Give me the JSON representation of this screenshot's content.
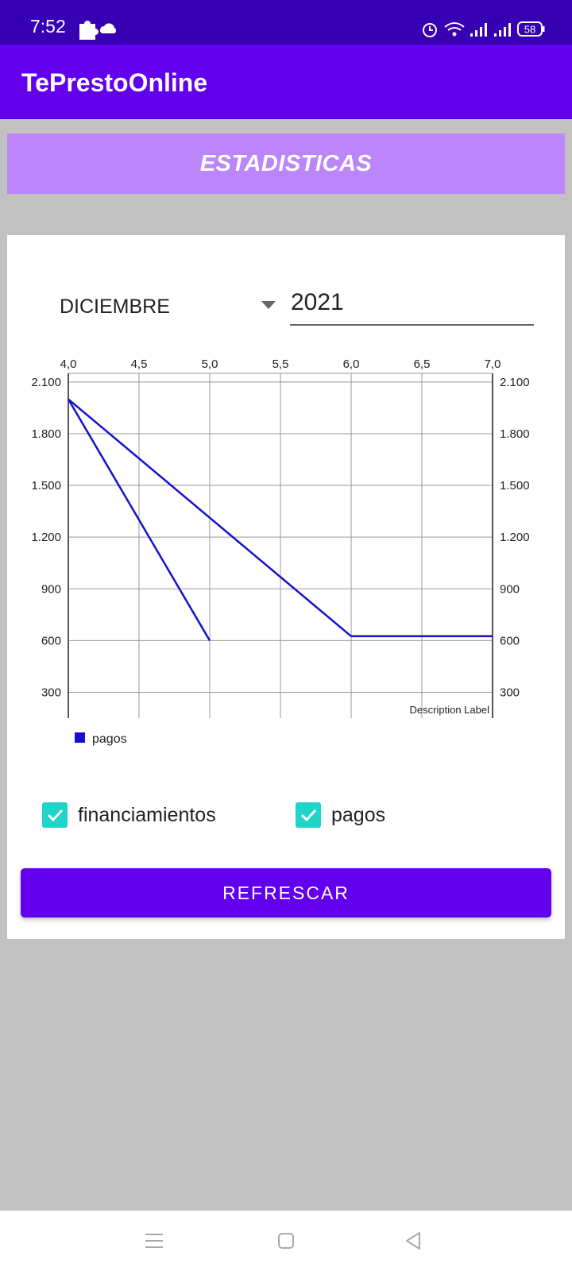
{
  "status_bar": {
    "time": "7:52",
    "battery": "58",
    "icons": [
      "puzzle-icon",
      "cloud-icon",
      "alarm-icon",
      "wifi-icon",
      "signal-icon",
      "signal-icon",
      "battery-icon"
    ]
  },
  "app_bar": {
    "title": "TePrestoOnline"
  },
  "banner": {
    "title": "ESTADISTICAS"
  },
  "filters": {
    "month": "DICIEMBRE",
    "year": "2021"
  },
  "chart_data": {
    "type": "line",
    "x_ticks": [
      "4,0",
      "4,5",
      "5,0",
      "5,5",
      "6,0",
      "6,5",
      "7,0"
    ],
    "y_ticks": [
      "300",
      "600",
      "900",
      "1.200",
      "1.500",
      "1.800",
      "2.100"
    ],
    "xlim": [
      4.0,
      7.0
    ],
    "ylim": [
      150,
      2150
    ],
    "grid": true,
    "legend_position": "bottom-left",
    "legend": [
      "pagos"
    ],
    "description": "Description Label",
    "series": [
      {
        "points": [
          [
            4.0,
            2000
          ],
          [
            5.0,
            600
          ]
        ],
        "color": "#1212cc"
      },
      {
        "name": "pagos",
        "points": [
          [
            4.0,
            2000
          ],
          [
            6.0,
            625
          ],
          [
            7.0,
            625
          ]
        ],
        "color": "#1212cc"
      }
    ]
  },
  "checkboxes": [
    {
      "label": "financiamientos",
      "checked": true
    },
    {
      "label": "pagos",
      "checked": true
    }
  ],
  "refresh_label": "REFRESCAR",
  "colors": {
    "status_bar": "#3700b3",
    "primary": "#6200ee",
    "banner": "#bb86fc",
    "checkbox": "#1fd4c8",
    "series": "#1212cc"
  },
  "nav_bar": {
    "icons": [
      "menu-icon",
      "home-icon",
      "back-icon"
    ]
  }
}
